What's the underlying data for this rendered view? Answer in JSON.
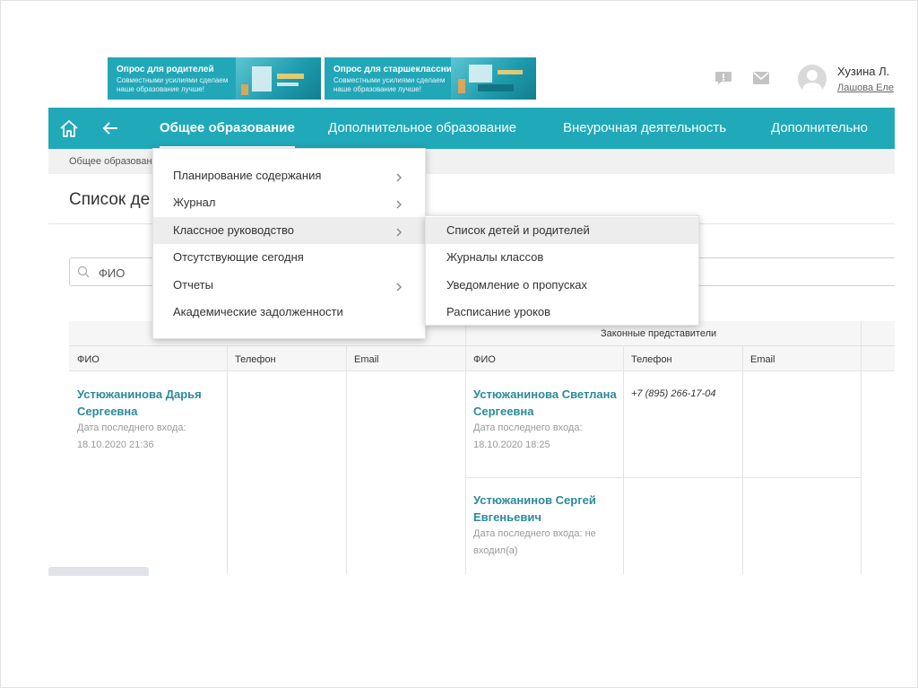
{
  "banners": [
    {
      "title": "Опрос для родителей",
      "subtitle": "Совместными усилиями сделаем наше образование лучше!"
    },
    {
      "title": "Опрос для старшеклассников",
      "subtitle": "Совместными усилиями сделаем наше образование лучше!"
    }
  ],
  "header": {
    "user_name": "Хузина Л.",
    "user_role": "Лашова Еле"
  },
  "nav": {
    "items": [
      {
        "label": "Общее образование",
        "active": true
      },
      {
        "label": "Дополнительное образование"
      },
      {
        "label": "Внеурочная деятельность"
      },
      {
        "label": "Дополнительно"
      }
    ]
  },
  "breadcrumb": "Общее образован",
  "page_title": "Список де",
  "search": {
    "placeholder": "ФИО"
  },
  "menu": {
    "items": [
      {
        "label": "Планирование содержания",
        "has_sub": true
      },
      {
        "label": "Журнал",
        "has_sub": true
      },
      {
        "label": "Классное руководство",
        "has_sub": true,
        "highlighted": true
      },
      {
        "label": "Отсутствующие сегодня"
      },
      {
        "label": "Отчеты",
        "has_sub": true
      },
      {
        "label": "Академические задолженности"
      }
    ]
  },
  "submenu": {
    "items": [
      {
        "label": "Список детей и родителей",
        "highlighted": true
      },
      {
        "label": "Журналы классов"
      },
      {
        "label": "Уведомление о пропусках"
      },
      {
        "label": "Расписание уроков"
      }
    ]
  },
  "table": {
    "group_header_right": "Законные представители",
    "columns": [
      "ФИО",
      "Телефон",
      "Email",
      "ФИО",
      "Телефон",
      "Email"
    ],
    "student": {
      "name": "Устюжанинова Дарья Сергеевна",
      "last_login": "Дата последнего входа: 18.10.2020 21:36"
    },
    "parents": [
      {
        "name": "Устюжанинова Светлана Сергеевна",
        "last_login": "Дата последнего входа: 18.10.2020 18:25",
        "phone": "+7 (895) 266-17-04"
      },
      {
        "name": "Устюжанинов Сергей Евгеньевич",
        "last_login": "Дата последнего входа: не входил(а)",
        "phone": ""
      }
    ]
  },
  "colors": {
    "accent": "#20a9b9",
    "link": "#2b8a9c"
  }
}
